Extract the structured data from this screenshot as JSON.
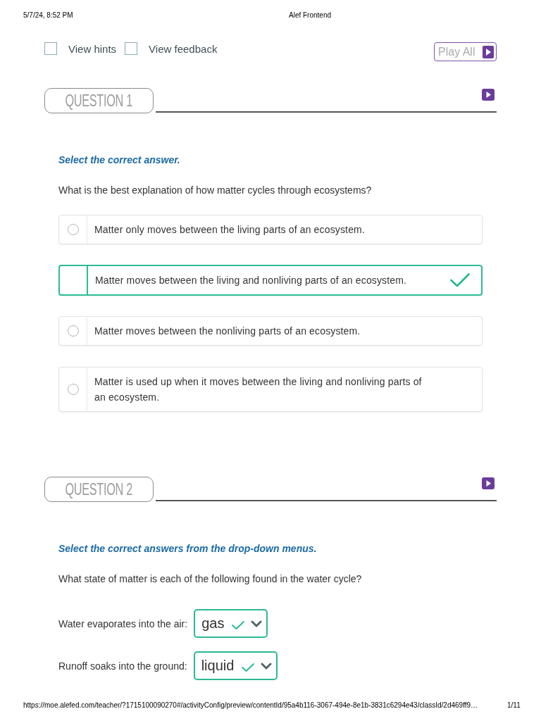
{
  "print_header": {
    "date": "5/7/24, 8:52 PM",
    "title": "Alef Frontend"
  },
  "toolbar": {
    "options": [
      {
        "label": "View hints",
        "checked": false
      },
      {
        "label": "View feedback",
        "checked": false
      }
    ],
    "play_all": "Play All"
  },
  "questions": [
    {
      "kind": "multiple_choice",
      "heading": "QUESTION 1",
      "instruction": "Select the correct answer.",
      "prompt": "What is the best explanation of how matter cycles through ecosystems?",
      "choices": [
        {
          "text": "Matter only moves between the living parts of an ecosystem.",
          "selected": false,
          "correct": false
        },
        {
          "text": "Matter moves between the living and nonliving parts of an ecosystem.",
          "selected": true,
          "correct": true
        },
        {
          "text": "Matter moves between the nonliving parts of an ecosystem.",
          "selected": false,
          "correct": false
        },
        {
          "text": "Matter is used up when it moves between the living and nonliving parts of an ecosystem.",
          "selected": false,
          "correct": false
        }
      ]
    },
    {
      "kind": "dropdowns",
      "heading": "QUESTION 2",
      "instruction": "Select the correct answers from the drop-down menus.",
      "prompt": "What state of matter is each of the following found in the water cycle?",
      "items": [
        {
          "label": "Water evaporates into the air:",
          "value": "gas",
          "correct": true
        },
        {
          "label": "Runoff soaks into the ground:",
          "value": "liquid",
          "correct": true
        }
      ]
    }
  ],
  "print_footer": {
    "url": "https://moe.alefed.com/teacher/?1715100090270#/activityConfig/preview/contentId/95a4b116-3067-494e-8e1b-3831c6294e43/classId/2d469ff9…",
    "page": "1/11"
  }
}
